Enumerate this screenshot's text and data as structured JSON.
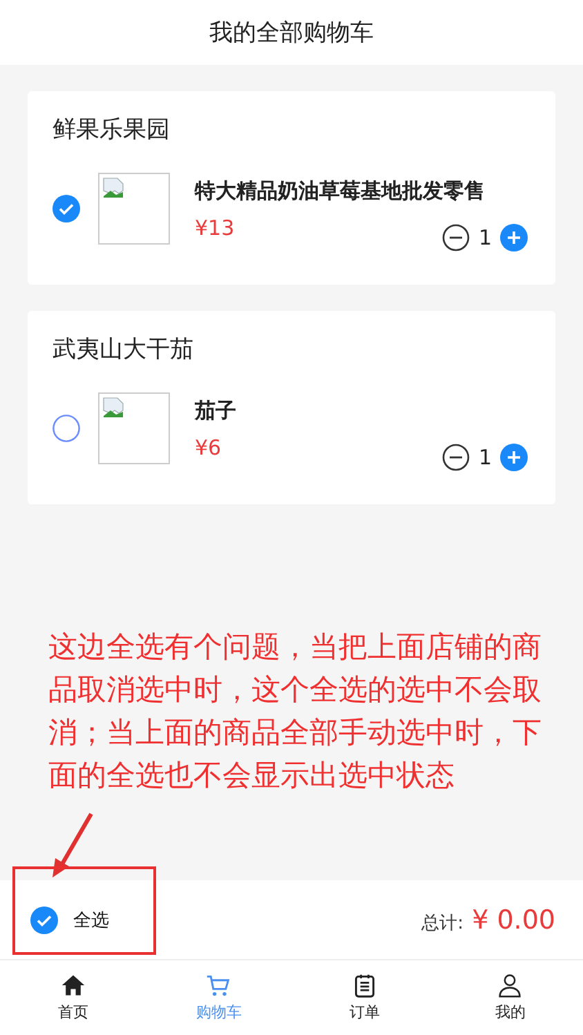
{
  "header": {
    "title": "我的全部购物车"
  },
  "shops": [
    {
      "name": "鲜果乐果园",
      "items": [
        {
          "name": "特大精品奶油草莓基地批发零售",
          "price": "¥13",
          "quantity": "1",
          "checked": true
        }
      ]
    },
    {
      "name": "武夷山大干茄",
      "items": [
        {
          "name": "茄子",
          "price": "¥6",
          "quantity": "1",
          "checked": false
        }
      ]
    }
  ],
  "annotation": {
    "text": "这边全选有个问题，当把上面店铺的商品取消选中时，这个全选的选中不会取消；当上面的商品全部手动选中时，下面的全选也不会显示出选中状态"
  },
  "footer": {
    "select_all": {
      "label": "全选",
      "checked": true
    },
    "total_label": "总计:",
    "total": "¥ 0.00"
  },
  "tabbar": [
    {
      "label": "首页",
      "kind": "home",
      "selected": false
    },
    {
      "label": "购物车",
      "kind": "cart",
      "selected": true
    },
    {
      "label": "订单",
      "kind": "order",
      "selected": false
    },
    {
      "label": "我的",
      "kind": "user",
      "selected": false
    }
  ]
}
